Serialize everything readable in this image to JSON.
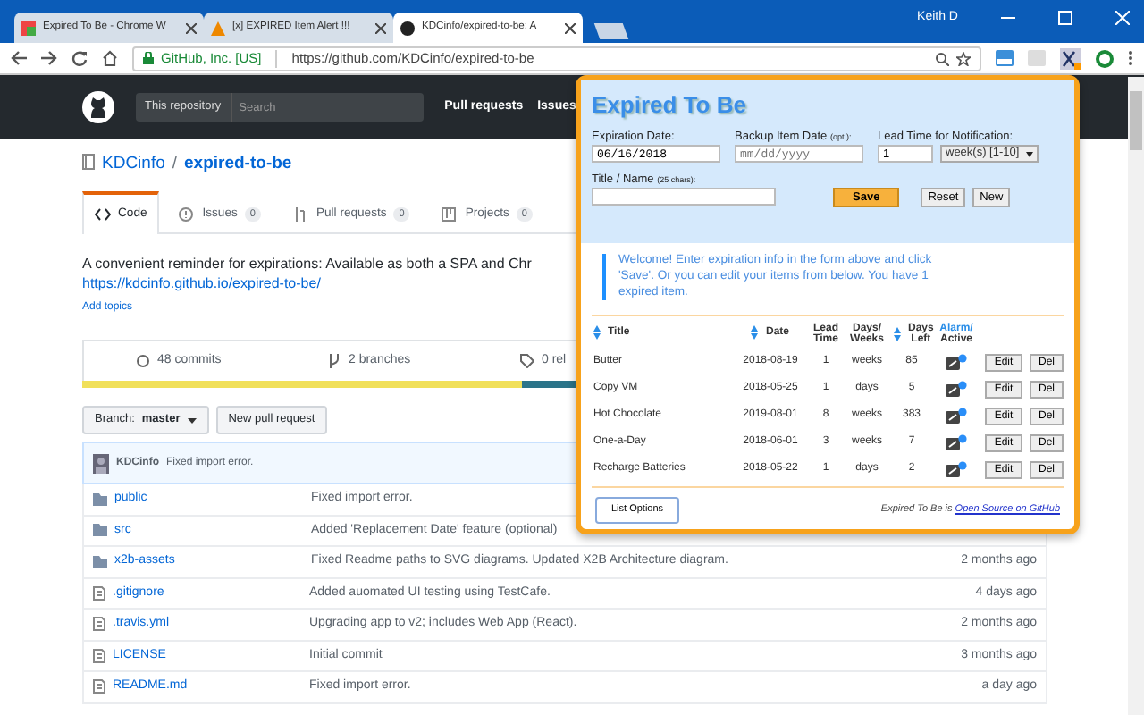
{
  "browser": {
    "tabs": [
      {
        "title": "Expired To Be - Chrome W",
        "selected": false
      },
      {
        "title": "[x] EXPIRED Item Alert !!!",
        "selected": false
      },
      {
        "title": "KDCinfo/expired-to-be: A",
        "selected": true
      }
    ],
    "user": "Keith D",
    "security_label": "GitHub, Inc. [US]",
    "url": "https://github.com/KDCinfo/expired-to-be"
  },
  "github": {
    "scope_label": "This repository",
    "search_placeholder": "Search",
    "nav": [
      "Pull requests",
      "Issues"
    ],
    "owner": "KDCinfo",
    "separator": "/",
    "repo": "expired-to-be",
    "tabs": [
      {
        "label": "Code",
        "selected": true
      },
      {
        "label": "Issues",
        "count": "0",
        "selected": false
      },
      {
        "label": "Pull requests",
        "count": "0",
        "selected": false
      },
      {
        "label": "Projects",
        "count": "0",
        "selected": false
      }
    ],
    "description": "A convenient reminder for expirations: Available as both a SPA and Chr",
    "homepage": "https://kdcinfo.github.io/expired-to-be/",
    "add_topics": "Add topics",
    "stats": [
      "48 commits",
      "2 branches",
      "0 rel"
    ],
    "branch_button": {
      "label": "Branch:",
      "value": "master"
    },
    "new_pull_request": "New pull request",
    "latest_commit": {
      "author": "KDCinfo",
      "message": "Fixed import error."
    },
    "files": [
      {
        "kind": "folder",
        "name": "public",
        "message": "Fixed import error."
      },
      {
        "kind": "folder",
        "name": "src",
        "message": "Added 'Replacement Date' feature (optional)"
      },
      {
        "kind": "folder",
        "name": "x2b-assets",
        "message": "Fixed Readme paths to SVG diagrams. Updated X2B Architecture diagram.",
        "age": "2 months ago"
      },
      {
        "kind": "file",
        "name": ".gitignore",
        "message": "Added auomated UI testing using TestCafe.",
        "age": "4 days ago"
      },
      {
        "kind": "file",
        "name": ".travis.yml",
        "message": "Upgrading app to v2; includes Web App (React).",
        "age": "2 months ago"
      },
      {
        "kind": "file",
        "name": "LICENSE",
        "message": "Initial commit",
        "age": "3 months ago"
      },
      {
        "kind": "file",
        "name": "README.md",
        "message": "Fixed import error.",
        "age": "a day ago"
      }
    ]
  },
  "popup": {
    "title": "Expired To Be",
    "form": {
      "expiration": {
        "label": "Expiration Date:",
        "value": "06/16/2018"
      },
      "backup": {
        "label": "Backup Item Date",
        "hint": "(opt.):",
        "placeholder": "mm/dd/yyyy"
      },
      "lead": {
        "label": "Lead Time for Notification:",
        "value": "1",
        "unit": "week(s) [1-10]"
      },
      "title": {
        "label": "Title / Name",
        "hint": "(25 chars):"
      },
      "buttons": [
        {
          "label": "Save",
          "kind": "primary"
        },
        {
          "label": "Reset",
          "kind": "plain"
        },
        {
          "label": "New",
          "kind": "plain"
        }
      ]
    },
    "message": "Welcome! Enter expiration info in the form above and click 'Save'. Or you can edit your items from below. You have 1 expired item.",
    "columns": [
      {
        "label": "Title",
        "sortable": true
      },
      {
        "label": "Date",
        "sortable": true
      },
      {
        "label": "Lead Time",
        "sortable": false
      },
      {
        "label": "Days/ Weeks",
        "sortable": false
      },
      {
        "label": "Days Left",
        "sortable": true
      },
      {
        "label": "Alarm/",
        "sub": "Active",
        "sortable": false
      }
    ],
    "rows": [
      {
        "title": "Butter",
        "date": "2018-08-19",
        "lead": "1",
        "unit": "weeks",
        "days_left": "85",
        "actions": [
          "Edit",
          "Del"
        ]
      },
      {
        "title": "Copy VM",
        "date": "2018-05-25",
        "lead": "1",
        "unit": "days",
        "days_left": "5",
        "actions": [
          "Edit",
          "Del"
        ]
      },
      {
        "title": "Hot Chocolate",
        "date": "2019-08-01",
        "lead": "8",
        "unit": "weeks",
        "days_left": "383",
        "actions": [
          "Edit",
          "Del"
        ]
      },
      {
        "title": "One-a-Day",
        "date": "2018-06-01",
        "lead": "3",
        "unit": "weeks",
        "days_left": "7",
        "actions": [
          "Edit",
          "Del"
        ]
      },
      {
        "title": "Recharge Batteries",
        "date": "2018-05-22",
        "lead": "1",
        "unit": "days",
        "days_left": "2",
        "actions": [
          "Edit",
          "Del"
        ]
      }
    ],
    "list_options": "List Options",
    "credit": "Expired To Be is",
    "credit_link": "Open Source on GitHub"
  }
}
